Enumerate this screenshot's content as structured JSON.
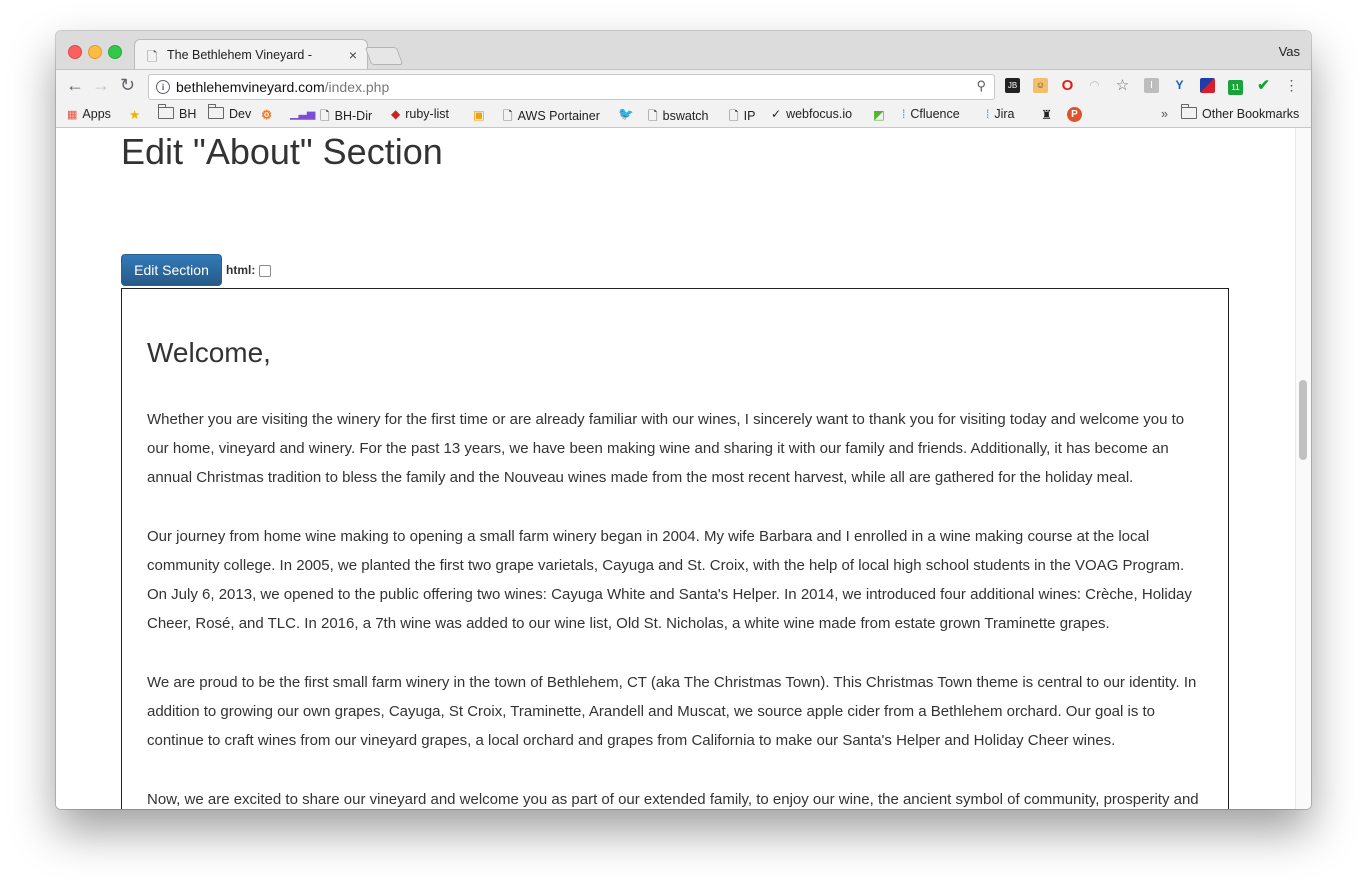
{
  "browser": {
    "tab_title": "The Bethlehem Vineyard -",
    "tab_close": "×",
    "profile_name": "Vas",
    "url_host": "bethlehemvineyard.com",
    "url_path": "/index.php",
    "nav": {
      "back": "←",
      "forward": "→",
      "reload": "↻"
    }
  },
  "bookmarks": {
    "apps": "Apps",
    "items": [
      "BH",
      "Dev",
      "BH-Dir",
      "ruby-list",
      "AWS Portainer",
      "bswatch",
      "IP",
      "webfocus.io",
      "Cfluence",
      "Jira"
    ],
    "overflow": "»",
    "other": "Other Bookmarks"
  },
  "page": {
    "title": "Edit \"About\" Section",
    "edit_button": "Edit Section",
    "html_label": "html:",
    "html_checked": false,
    "heading": "Welcome,",
    "paragraphs": [
      "Whether you are visiting the winery for the first time or are already familiar with our wines, I sincerely want to thank you for visiting today and welcome you to our home, vineyard and winery. For the past 13 years, we have been making wine and sharing it with our family and friends. Additionally, it has become an annual Christmas tradition to bless the family and the Nouveau wines made from the most recent harvest, while all are gathered for the holiday meal.",
      "Our journey from home wine making to opening a small farm winery began in 2004. My wife Barbara and I enrolled in a wine making course at the local community college. In 2005, we planted the first two grape varietals, Cayuga and St. Croix, with the help of local high school students in the VOAG Program. On July 6, 2013, we opened to the public offering two wines: Cayuga White and Santa's Helper. In 2014, we introduced four additional wines: Crèche, Holiday Cheer, Rosé, and TLC. In 2016, a 7th wine was added to our wine list, Old St. Nicholas, a white wine made from estate grown Traminette grapes.",
      "We are proud to be the first small farm winery in the town of Bethlehem, CT (aka The Christmas Town). This Christmas Town theme is central to our identity. In addition to growing our own grapes, Cayuga, St Croix, Traminette, Arandell and Muscat, we source apple cider from a Bethlehem orchard. Our goal is to continue to craft wines from our vineyard grapes, a local orchard and grapes from California to make our Santa's Helper and Holiday Cheer wines.",
      "Now, we are excited to share our vineyard and welcome you as part of our extended family, to enjoy our wine, the ancient symbol of community, prosperity and well-being. Come and enjoy a friendly, warm, charming, delicious winery experience."
    ]
  },
  "colors": {
    "button_primary": "#2d6ca2",
    "text": "#333333"
  }
}
